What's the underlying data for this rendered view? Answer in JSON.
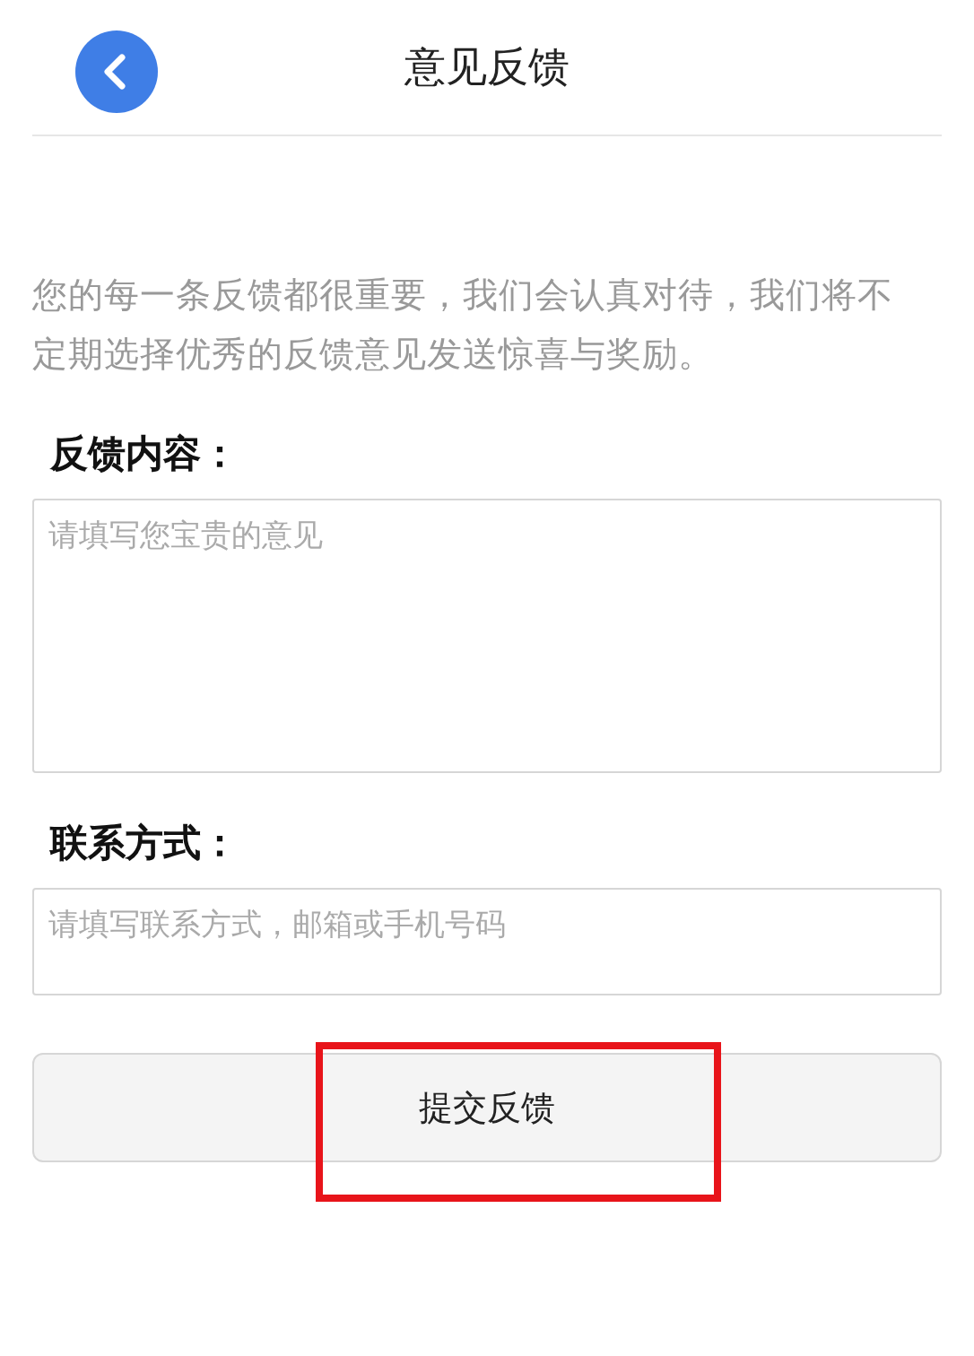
{
  "header": {
    "title": "意见反馈"
  },
  "intro": "您的每一条反馈都很重要，我们会认真对待，我们将不定期选择优秀的反馈意见发送惊喜与奖励。",
  "content": {
    "label": "反馈内容：",
    "placeholder": "请填写您宝贵的意见"
  },
  "contact": {
    "label": "联系方式：",
    "placeholder": "请填写联系方式，邮箱或手机号码"
  },
  "submit": {
    "label": "提交反馈",
    "highlighted": true
  }
}
